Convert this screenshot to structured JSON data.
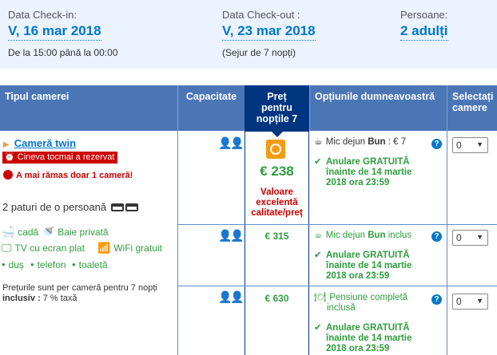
{
  "stay": {
    "checkin_label": "Data Check-in:",
    "checkin_value": "V, 16 mar 2018",
    "checkin_time": "De la 15:00 până la 00:00",
    "checkout_label": "Data Check-out :",
    "checkout_value": "V, 23 mar 2018",
    "checkout_note": "(Sejur de 7 nopți)",
    "guests_label": "Persoane:",
    "guests_value": "2 adulți"
  },
  "table": {
    "headers": {
      "room_type": "Tipul camerei",
      "capacity": "Capacitate",
      "price_line1": "Preț",
      "price_line2": "pentru",
      "price_line3": "nopțile 7",
      "options": "Opțiunile dumneavoastră",
      "select_line1": "Selectați",
      "select_line2": "camere"
    }
  },
  "room": {
    "name": "Cameră twin",
    "booked_badge": "Cineva tocmai a rezervat",
    "remaining": "A mai rămas doar 1 cameră!",
    "beds": "2 paturi de o persoană",
    "facilities": {
      "bath": "cadă",
      "private_bathroom": "Baie privată",
      "tv": "TV cu ecran plat",
      "wifi": "WiFi gratuit",
      "shower": "duș",
      "phone": "telefon",
      "toilet": "toaletă"
    },
    "prices_note_line1": "Prețurile sunt per cameră pentru 7 nopți",
    "prices_note_bold": "inclusiv :",
    "prices_note_tail": " 7 % taxă"
  },
  "offers": [
    {
      "price": "€ 238",
      "badge": "Valoare excelentă calitate/preț",
      "meal_prefix": "Mic dejun ",
      "meal_bold": "Bun",
      "meal_suffix": " : € 7",
      "cancel_line1": "Anulare GRATUITĂ",
      "cancel_line2": "înainte de 14 martie",
      "cancel_line3": "2018 ora 23:59",
      "select_value": "0"
    },
    {
      "price": "€ 315",
      "meal_prefix": "Mic dejun ",
      "meal_bold": "Bun",
      "meal_suffix": " inclus",
      "cancel_line1": "Anulare GRATUITĂ",
      "cancel_line2": "înainte de 14 martie",
      "cancel_line3": "2018 ora 23:59",
      "select_value": "0"
    },
    {
      "price": "€ 630",
      "meal_line1": "Pensiune completă",
      "meal_line2": "inclusă",
      "cancel_line1": "Anulare GRATUITĂ",
      "cancel_line2": "înainte de 14 martie",
      "cancel_line3": "2018 ora 23:59",
      "select_value": "0"
    }
  ],
  "icons": {
    "help": "?",
    "caret": "▼"
  },
  "colors": {
    "header_blue": "#4b76b6",
    "price_header": "#003580",
    "link_blue": "#0077cc",
    "green": "#2e9e3e",
    "red": "#cc0000",
    "top_panel": "#ebf3ff"
  }
}
